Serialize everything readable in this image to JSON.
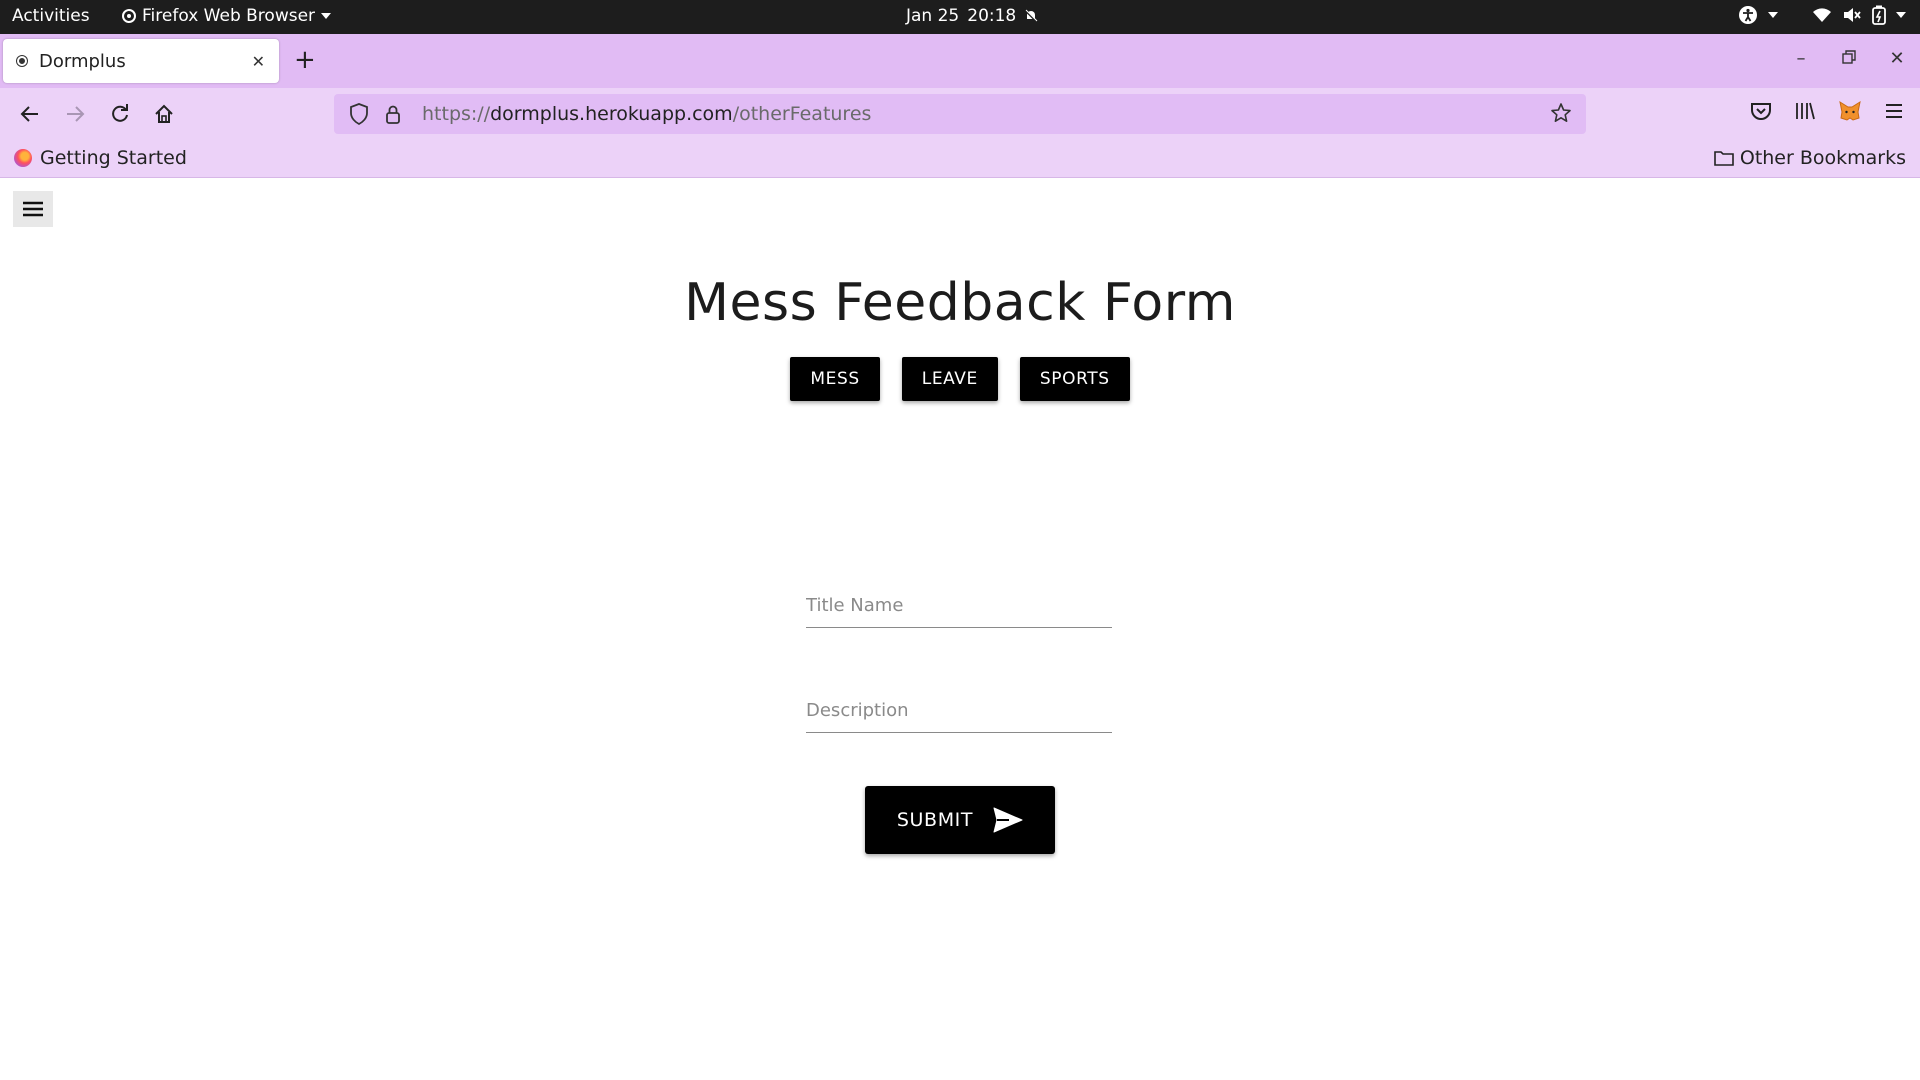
{
  "system_bar": {
    "activities": "Activities",
    "app_name": "Firefox Web Browser",
    "date": "Jan 25",
    "time": "20:18"
  },
  "browser": {
    "tab_title": "Dormplus",
    "url_protocol": "https://",
    "url_host": "dormplus.herokuapp.com",
    "url_path": "/otherFeatures",
    "bookmarks": {
      "left_label": "Getting Started",
      "right_label": "Other Bookmarks"
    }
  },
  "page": {
    "title": "Mess Feedback Form",
    "tabs": [
      {
        "label": "MESS"
      },
      {
        "label": "LEAVE"
      },
      {
        "label": "SPORTS"
      }
    ],
    "form": {
      "title_placeholder": "Title Name",
      "description_placeholder": "Description",
      "submit_label": "SUBMIT"
    }
  },
  "icons": {
    "hamburger": "menu-icon",
    "submit": "send-icon"
  }
}
